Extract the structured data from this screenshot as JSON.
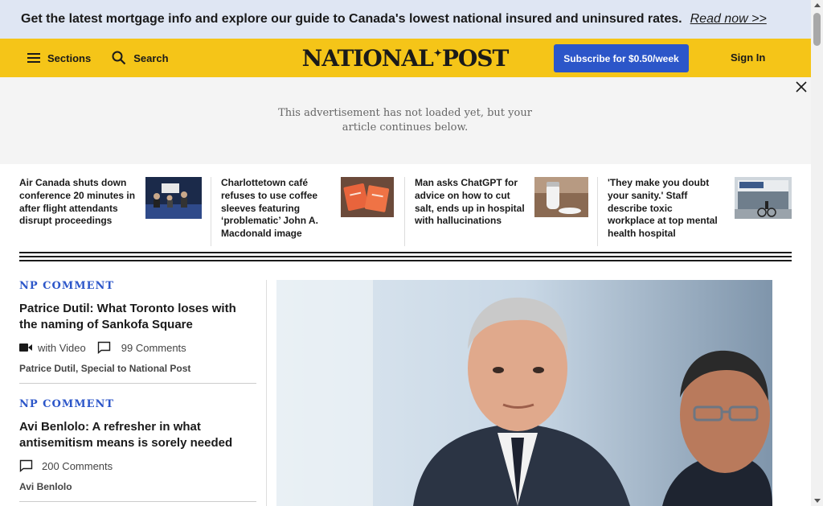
{
  "promo": {
    "text": "Get the latest mortgage info and explore our guide to Canada's lowest national insured and uninsured rates.",
    "link": "Read now >>"
  },
  "header": {
    "sections_label": "Sections",
    "search_label": "Search",
    "logo_left": "NATIONAL",
    "logo_right": "POST",
    "subscribe_label": "Subscribe for $0.50/week",
    "signin_label": "Sign In",
    "accent": "#f5c518",
    "button_color": "#2c56c9"
  },
  "ad": {
    "message": "This advertisement has not loaded yet, but your article continues below."
  },
  "stories": [
    {
      "title": "Air Canada shuts down conference 20 minutes in after flight attendants disrupt proceedings"
    },
    {
      "title": "Charlottetown café refuses to use coffee sleeves featuring ‘problematic’ John A. Macdonald image"
    },
    {
      "title": "Man asks ChatGPT for advice on how to cut salt, ends up in hospital with hallucinations"
    },
    {
      "title": "'They make you doubt your sanity.' Staff describe toxic workplace at top mental health hospital"
    }
  ],
  "articles": [
    {
      "eyebrow": "NP COMMENT",
      "headline": "Patrice Dutil: What Toronto loses with the naming of Sankofa Square",
      "video_label": "with Video",
      "comments": "99 Comments",
      "byline": "Patrice Dutil, Special to National Post"
    },
    {
      "eyebrow": "NP COMMENT",
      "headline": "Avi Benlolo: A refresher in what antisemitism means is sorely needed",
      "comments": "200 Comments",
      "byline": "Avi Benlolo"
    }
  ]
}
